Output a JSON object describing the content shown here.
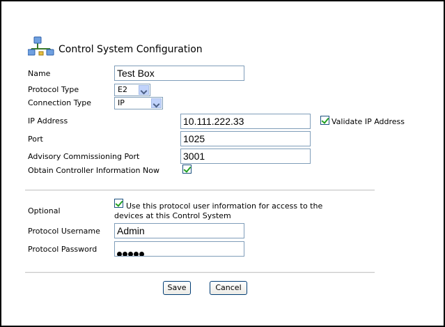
{
  "title": "Control System Configuration",
  "icon": "network-icon",
  "form": {
    "name": {
      "label": "Name",
      "value": "Test Box"
    },
    "protocol_type": {
      "label": "Protocol Type",
      "value": "E2"
    },
    "connection_type": {
      "label": "Connection Type",
      "value": "IP"
    },
    "ip_address": {
      "label": "IP Address",
      "value": "10.111.222.33"
    },
    "validate_ip": {
      "label": "Validate IP Address",
      "checked": true
    },
    "port": {
      "label": "Port",
      "value": "1025"
    },
    "advisory_port": {
      "label": "Advisory Commissioning Port",
      "value": "3001"
    },
    "obtain_info": {
      "label": "Obtain Controller Information Now",
      "checked": true
    }
  },
  "optional": {
    "label": "Optional",
    "use_protocol_info": {
      "checked": true,
      "line1": "Use this protocol user information for access to the",
      "line2": "devices at this Control System"
    },
    "username": {
      "label": "Protocol Username",
      "value": "Admin"
    },
    "password": {
      "label": "Protocol Password",
      "length": 5
    }
  },
  "buttons": {
    "save": "Save",
    "cancel": "Cancel"
  },
  "colors": {
    "input_border": "#7f9db9",
    "check": "#21a121",
    "button_border": "#003c74"
  }
}
